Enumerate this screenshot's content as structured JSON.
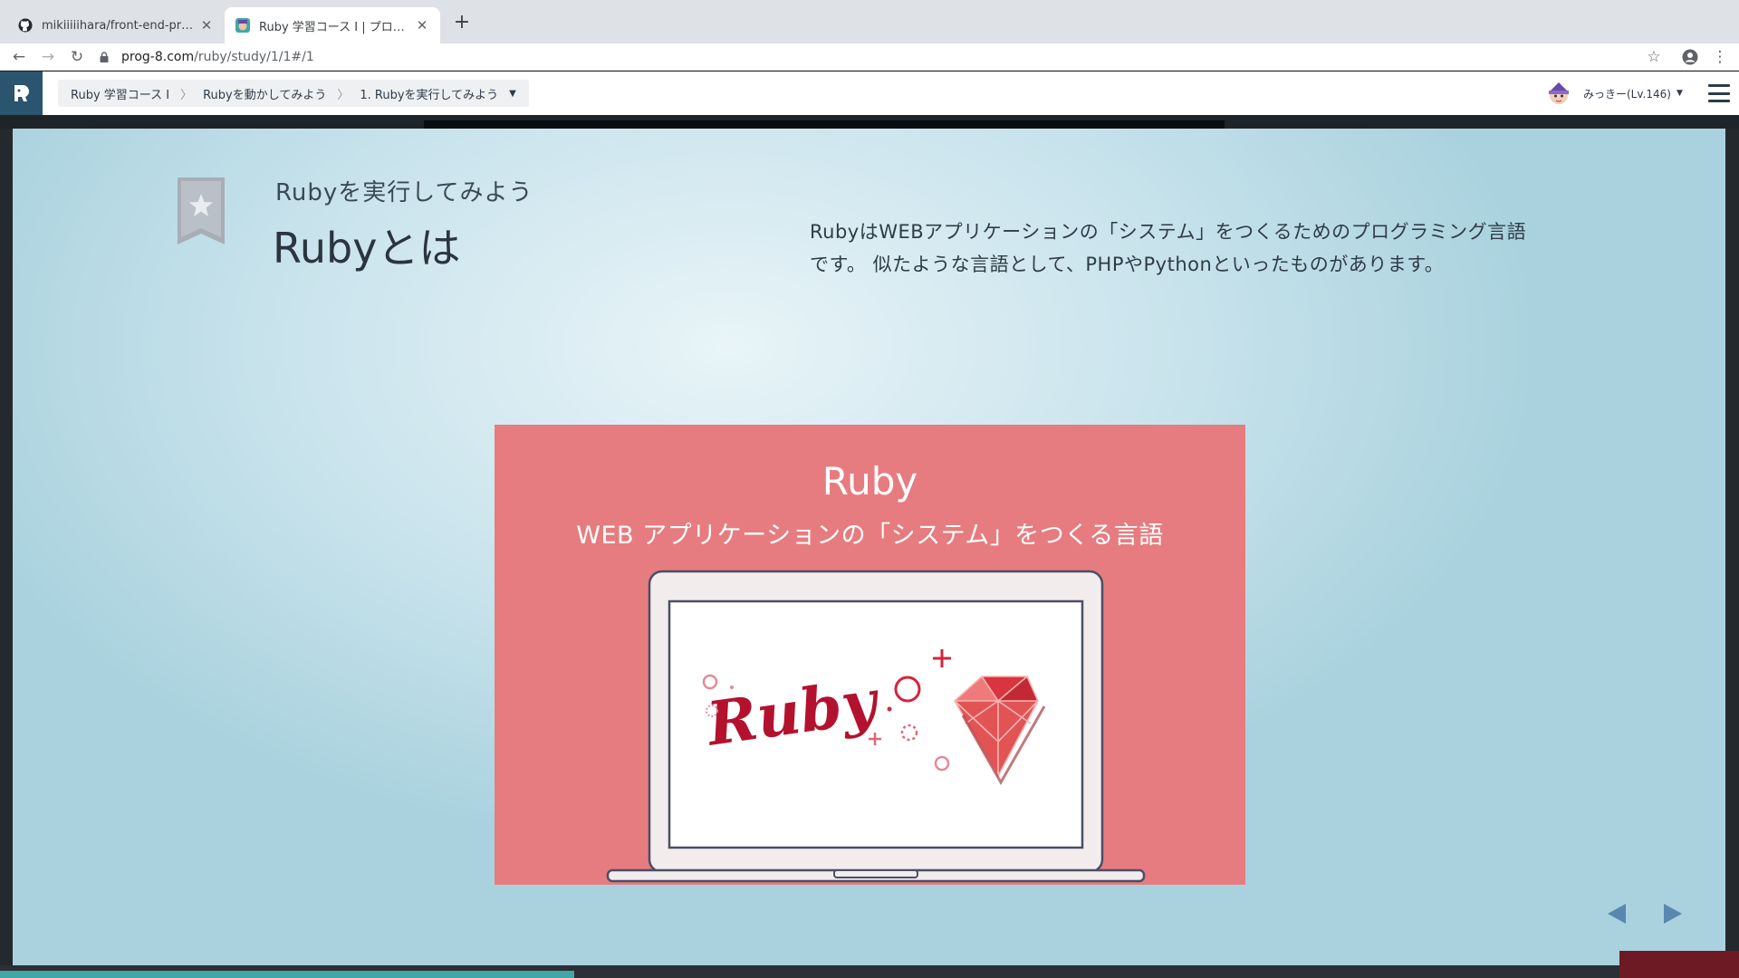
{
  "browser": {
    "tabs": [
      {
        "title": "mikiiiiihara/front-end-practice",
        "favicon": "github-icon",
        "active": false
      },
      {
        "title": "Ruby 学習コース I | プログラミング",
        "favicon": "progate-icon",
        "active": true
      }
    ],
    "new_tab_label": "+",
    "url_host": "prog-8.com",
    "url_path": "/ruby/study/1/1#/1"
  },
  "header": {
    "breadcrumb": [
      "Ruby 学習コース Ⅰ",
      "Rubyを動かしてみよう",
      "1. Rubyを実行してみよう"
    ],
    "user_name": "みっきー(Lv.146)"
  },
  "slide": {
    "subtitle": "Rubyを実行してみよう",
    "title": "Rubyとは",
    "description": "RubyはWEBアプリケーションの「システム」をつくるためのプログラミング言語です。 似たような言語として、PHPやPythonといったものがあります。",
    "figure": {
      "title": "Ruby",
      "subtitle": "WEB アプリケーションの「システム」をつくる言語",
      "screen_logo": "Ruby"
    }
  },
  "colors": {
    "accent": "#2b546e",
    "figure_bg": "#e67c7f",
    "ruby_red": "#b3122e",
    "progress": "#3fa8a6"
  },
  "progress_fraction": 0.33
}
